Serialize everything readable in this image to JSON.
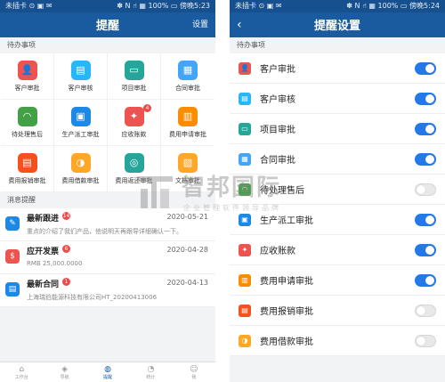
{
  "left": {
    "status": {
      "carrier": "未插卡 ⊙ ▣ ✉",
      "right": "✽ N ⑁ ▦ 100% ▭ 傍晚5:23"
    },
    "title": "提醒",
    "settings_label": "设置",
    "section_todo": "待办事项",
    "grid": [
      {
        "label": "客户审批",
        "icon": "user-icon",
        "color": "#ef5350",
        "glyph": "👤"
      },
      {
        "label": "客户审核",
        "icon": "id-card-icon",
        "color": "#29b6f6",
        "glyph": "▤"
      },
      {
        "label": "项目审批",
        "icon": "folder-icon",
        "color": "#26a69a",
        "glyph": "▭"
      },
      {
        "label": "合同审批",
        "icon": "contract-icon",
        "color": "#42a5f5",
        "glyph": "▦"
      },
      {
        "label": "待处理售后",
        "icon": "headset-icon",
        "color": "#43a047",
        "glyph": "◠"
      },
      {
        "label": "生产派工审批",
        "icon": "production-icon",
        "color": "#1e88e5",
        "glyph": "▣"
      },
      {
        "label": "应收账款",
        "icon": "receivable-icon",
        "color": "#ef5350",
        "glyph": "✦",
        "badge": "4"
      },
      {
        "label": "费用申请审批",
        "icon": "expense-icon",
        "color": "#fb8c00",
        "glyph": "▥"
      },
      {
        "label": "费用报销审批",
        "icon": "reimburse-icon",
        "color": "#f4511e",
        "glyph": "▤"
      },
      {
        "label": "费用借款审批",
        "icon": "loan-icon",
        "color": "#ffa726",
        "glyph": "◑"
      },
      {
        "label": "费用返还审批",
        "icon": "refund-icon",
        "color": "#26a69a",
        "glyph": "◎"
      },
      {
        "label": "文档审批",
        "icon": "document-icon",
        "color": "#ffa726",
        "glyph": "▧"
      }
    ],
    "section_msgs": "消息提醒",
    "messages": [
      {
        "title": "最新跟进",
        "badge": "14",
        "date": "2020-05-21",
        "sub": "重点的介绍了我们产品，他说明天再跟导详细确认一下。",
        "icon": "follow-icon",
        "color": "#1e88e5",
        "glyph": "✎"
      },
      {
        "title": "应开发票",
        "badge": "6",
        "date": "2020-04-28",
        "sub": "RMB 25,000.0000",
        "icon": "invoice-icon",
        "color": "#ef5350",
        "glyph": "$"
      },
      {
        "title": "最新合同",
        "badge": "1",
        "date": "2020-04-13",
        "sub": "上海瑞伯能源科技有限公司HT_20200413006",
        "icon": "contract-icon",
        "color": "#1e88e5",
        "glyph": "▤"
      }
    ],
    "tabs": [
      {
        "label": "工作台",
        "icon": "workbench-icon",
        "glyph": "⌂"
      },
      {
        "label": "导航",
        "icon": "compass-icon",
        "glyph": "◈"
      },
      {
        "label": "提醒",
        "icon": "chat-icon",
        "glyph": "◍",
        "active": true
      },
      {
        "label": "统计",
        "icon": "pie-chart-icon",
        "glyph": "◔"
      },
      {
        "label": "我",
        "icon": "profile-icon",
        "glyph": "☺"
      }
    ]
  },
  "right": {
    "status": {
      "carrier": "未插卡 ⊙ ▣ ✉",
      "right": "✽ N ⑁ ▦ 100% ▭ 傍晚5:24"
    },
    "title": "提醒设置",
    "back_label": "‹",
    "section_todo": "待办事项",
    "rows": [
      {
        "label": "客户审批",
        "icon": "user-icon",
        "color": "#ef5350",
        "glyph": "👤",
        "on": true
      },
      {
        "label": "客户审核",
        "icon": "id-card-icon",
        "color": "#29b6f6",
        "glyph": "▤",
        "on": true
      },
      {
        "label": "项目审批",
        "icon": "folder-icon",
        "color": "#26a69a",
        "glyph": "▭",
        "on": true
      },
      {
        "label": "合同审批",
        "icon": "contract-icon",
        "color": "#42a5f5",
        "glyph": "▦",
        "on": true
      },
      {
        "label": "待处理售后",
        "icon": "headset-icon",
        "color": "#43a047",
        "glyph": "◠",
        "on": false
      },
      {
        "label": "生产派工审批",
        "icon": "production-icon",
        "color": "#1e88e5",
        "glyph": "▣",
        "on": true
      },
      {
        "label": "应收账款",
        "icon": "receivable-icon",
        "color": "#ef5350",
        "glyph": "✦",
        "on": true
      },
      {
        "label": "费用申请审批",
        "icon": "expense-icon",
        "color": "#fb8c00",
        "glyph": "▥",
        "on": true
      },
      {
        "label": "费用报销审批",
        "icon": "reimburse-icon",
        "color": "#f4511e",
        "glyph": "▤",
        "on": false
      },
      {
        "label": "费用借款审批",
        "icon": "loan-icon",
        "color": "#ffa726",
        "glyph": "◑",
        "on": false
      }
    ]
  },
  "watermark": {
    "main": "智邦国际",
    "sub": "企业管理软件领导品牌"
  },
  "colors": {
    "header": "#1a5a9e",
    "toggle_on": "#2379e8",
    "badge": "#ef4a4a"
  }
}
